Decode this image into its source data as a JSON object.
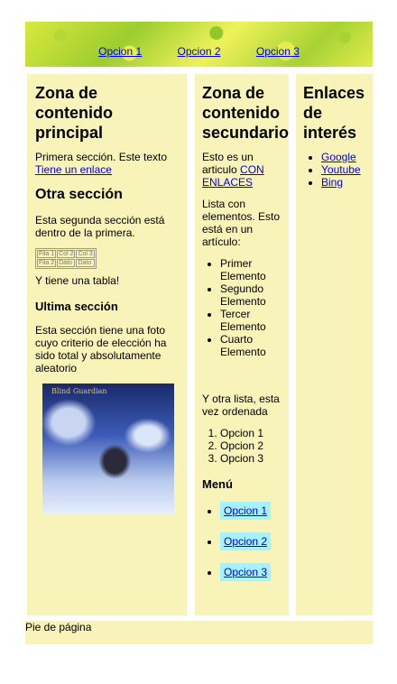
{
  "nav": {
    "links": [
      "Opcion 1",
      "Opcion 2",
      "Opcion 3"
    ]
  },
  "main": {
    "title": "Zona de contenido principal",
    "intro_text": "Primera sección. Este texto",
    "intro_link": "Tiene un enlace",
    "section2_title": "Otra sección",
    "section2_text": "Esta segunda sección está dentro de la primera.",
    "table": [
      [
        "Fila 1",
        "Col 2",
        "Col 3"
      ],
      [
        "Fila 2",
        "Dato",
        "Dato"
      ]
    ],
    "table_caption": "Y tiene una tabla!",
    "section3_title": "Ultima sección",
    "section3_text": "Esta sección tiene una foto cuyo criterio de elección ha sido total y absolutamente aleatorio",
    "photo_text": "Blind Guardian"
  },
  "secondary": {
    "title": "Zona de contenido secundario",
    "article_text": "Esto es un articulo",
    "article_link": "CON ENLACES",
    "list_intro": "Lista con elementos. Esto está en un artículo:",
    "list": [
      "Primer Elemento",
      "Segundo Elemento",
      "Tercer Elemento",
      "Cuarto Elemento"
    ],
    "ordered_intro": "Y otra lista, esta vez ordenada",
    "ordered": [
      "Opcion 1",
      "Opcion 2",
      "Opcion 3"
    ],
    "menu_title": "Menú",
    "menu": [
      "Opcion 1",
      "Opcion 2",
      "Opcion 3"
    ]
  },
  "links": {
    "title": "Enlaces de interés",
    "items": [
      "Google",
      "Youtube",
      "Bing"
    ]
  },
  "footer": {
    "text": "Pie de página"
  },
  "colors": {
    "panel": "#f8f3b8",
    "menu_highlight": "#a6f3ff",
    "link": "#0000ee"
  }
}
